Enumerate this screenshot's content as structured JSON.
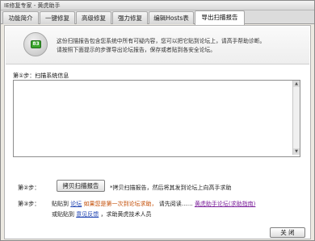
{
  "window": {
    "title": "IE修复专家 - 黄虎助手"
  },
  "tabs": [
    {
      "label": "功能简介",
      "active": false
    },
    {
      "label": "一键修复",
      "active": false
    },
    {
      "label": "高级修复",
      "active": false
    },
    {
      "label": "强力修复",
      "active": false
    },
    {
      "label": "编辑Hosts表",
      "active": false
    },
    {
      "label": "导出扫描报告",
      "active": true
    }
  ],
  "banner": {
    "icon": "report-icon",
    "icon_text": "83",
    "line1": "这份扫描报告包含您系统中所有可疑内容，您可以把它贴到论坛上，请高手帮助诊断。",
    "line2": "请按照下面提示的步骤导出论坛报告，保存或者贴到各安全论坛。"
  },
  "step1": {
    "label": "第①步：扫描系统信息"
  },
  "report_text": {
    "value": ""
  },
  "step2": {
    "label": "第②步：",
    "button": "拷贝扫描报告",
    "hint": "*拷贝扫描报告，然后将其发到论坛上向高手求助"
  },
  "step3": {
    "label": "第③步：",
    "prefix": "贴贴到",
    "forum_link": "论坛",
    "warn_text": "如果您是第一次到论坛求助，",
    "read_text": "请先阅读……",
    "help_link": "黄虎助手论坛(求助指南)",
    "line2_prefix": "或贴贴到",
    "feedback_link": "意见反馈",
    "line2_suffix": "，求助黄虎技术人员"
  },
  "close_button": "关 闭"
}
